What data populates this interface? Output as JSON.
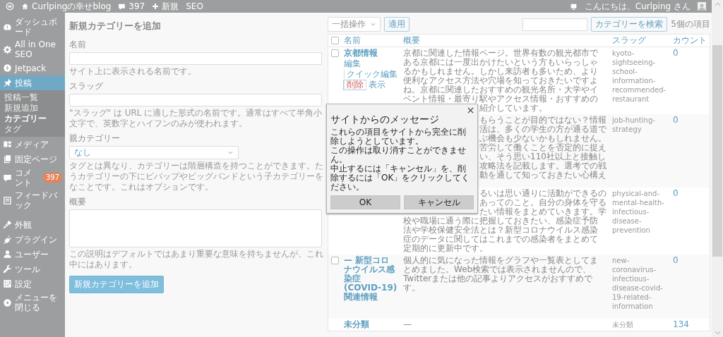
{
  "admin_bar": {
    "site": "Curlpingの幸せblog",
    "comments": "397",
    "new": "新規",
    "seo": "SEO",
    "greeting": "こんにちは、Curlping さん"
  },
  "sidebar": {
    "menu": [
      {
        "label": "ダッシュボード",
        "selected": false
      },
      {
        "label": "All in One SEO",
        "selected": false
      },
      {
        "label": "Jetpack",
        "selected": false
      },
      {
        "label": "投稿",
        "selected": true,
        "children": [
          {
            "label": "投稿一覧",
            "selected": false
          },
          {
            "label": "新規追加",
            "selected": false
          },
          {
            "label": "カテゴリー",
            "selected": true
          },
          {
            "label": "タグ",
            "selected": false
          }
        ]
      },
      {
        "label": "メディア",
        "selected": false
      },
      {
        "label": "固定ページ",
        "selected": false
      },
      {
        "label": "コメント",
        "selected": false,
        "badge": "397"
      },
      {
        "label": "フィードバック",
        "selected": false
      }
    ],
    "menu_2": [
      {
        "label": "外観",
        "selected": false
      },
      {
        "label": "プラグイン",
        "selected": false
      },
      {
        "label": "ユーザー",
        "selected": false
      },
      {
        "label": "ツール",
        "selected": false
      },
      {
        "label": "設定",
        "selected": false
      }
    ],
    "collapse": "メニューを閉じる"
  },
  "form": {
    "title": "新規カテゴリーを追加",
    "fields": [
      {
        "kind": "input",
        "label": "名前",
        "help": [
          "サイト上に表示される名前です。"
        ]
      },
      {
        "kind": "input",
        "label": "スラッグ",
        "help": [
          "\"スラッグ\" は URL に適した形式の名前です。通常はすべて半角小文字で、英数字とハイフンのみが使われます。"
        ]
      },
      {
        "kind": "select",
        "label": "親カテゴリー",
        "value": "なし",
        "help": [
          "タグとは異なり、カテゴリーは階層構造を持つことができます。た",
          "うカテゴリーの下にビバップやビッグバンドという子カテゴリーを",
          "なことです。これはオプションです。"
        ]
      },
      {
        "kind": "textarea",
        "label": "概要",
        "help": [
          "この説明はデフォルトではあまり重要な意味を持ちませんが、これ",
          "中にはあります。"
        ]
      }
    ],
    "submit": "新規カテゴリーを追加"
  },
  "table": {
    "search_button": "カテゴリーを検索",
    "bulk_action": "一括操作",
    "apply": "適用",
    "item_count": "5個の項目",
    "select_all": {
      "checked": false
    },
    "columns": [
      "名前",
      "概要",
      "スラッグ",
      "カウント"
    ],
    "rows": [
      {
        "checked": false,
        "name": "京都情報",
        "actions": [
          {
            "label": "編集",
            "kind": "link"
          },
          {
            "label": "クイック編集",
            "kind": "link"
          },
          {
            "label": "削除",
            "kind": "delete"
          },
          {
            "label": "表示",
            "kind": "link"
          }
        ],
        "description": [
          "京都に関連した情報ページ。世界有数の観光都市で",
          "ある京都には一度出かけたいという方もいらっしゃ",
          "るかもしれません。しかし来訪者も多いため、より",
          "便利なアクセス方法や穴場を知っておきたいですよ",
          "ね。京都に関連したおすすめの観光名所・大学やイ",
          "ベント情報・最寄り駅やアクセス情報・おすすめの"
        ],
        "description_end": [
          "紹介しています。"
        ],
        "slug": "kyoto-sightseeing-school-information-recommended-restaurant",
        "count": "0"
      },
      {
        "description_start": [
          "もらうことが目的ではない？情報",
          "活は、多くの学生の方が通る道で",
          "ぶ機会も少ないかもしれません。",
          "苦労して働くことを否定的に捉え",
          "い、そう思い110社以上と接触し",
          "攻略法を記載します。選考での戦",
          "動を通して知っておきたい心構え"
        ],
        "slug": "job-hunting-strategy",
        "count": "0"
      },
      {
        "description_start": [
          "るいは思い通りに活動ができるの",
          "あってのこと。自分の身体を守る",
          "たい情報をまとめていきます。学"
        ],
        "description": [
          "校や職場に通う際に把握しておきたい、感染症予防",
          "法や学校保健安全法とは？新型コロナウイルス感染",
          "症のデータに関してはこれまでの感染者をまとめて",
          "定期的に更新中です。"
        ],
        "slug": "physical-and-mental-health-infectious-disease-prevention",
        "count": "0"
      },
      {
        "checked": false,
        "name": "— 新型コロナウイルス感染症(COVID-19)関連情報",
        "description": [
          "個人的に気になった情報をグラフや一覧表としてま",
          "とめました。Web検索では表示されませんので、",
          "Twitterまたは他の記事よりアクセスがおすすめで",
          "す。"
        ],
        "slug": "new-coronavirus-infectious-disease-covid-19-related-information",
        "count": "0"
      },
      {
        "name": "未分類",
        "description": [
          "—"
        ],
        "slug": "未分類",
        "count": "134"
      }
    ]
  },
  "dialog": {
    "title": "サイトからのメッセージ",
    "message": [
      "これらの項目をサイトから完全に削除しようとしています。",
      "この操作は取り消すことができません。",
      "中止するには「キャンセル」を、削除するには「OK」をクリックしてください。"
    ],
    "buttons": [
      {
        "label": "OK"
      },
      {
        "label": "キャンセル"
      }
    ]
  }
}
